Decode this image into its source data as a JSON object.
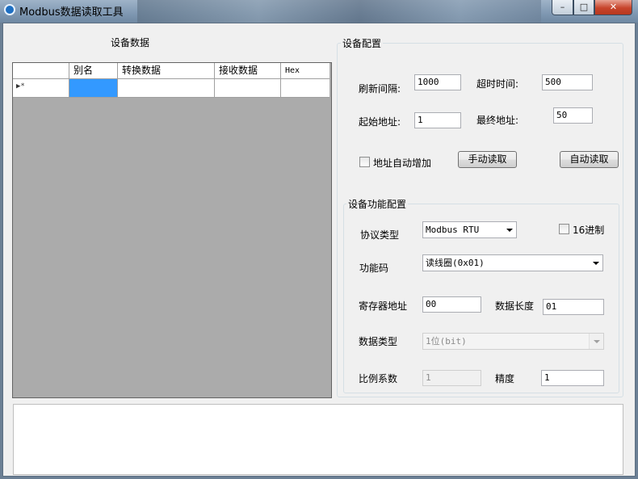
{
  "window": {
    "title": "Modbus数据读取工具",
    "controls": {
      "minimize": "–",
      "maximize": "□",
      "close": "✕"
    }
  },
  "grid": {
    "title": "设备数据",
    "columns": [
      "别名",
      "转换数据",
      "接收数据",
      "Hex"
    ],
    "new_row_marker": "▶*"
  },
  "config": {
    "legend": "设备配置",
    "refresh_label": "刷新间隔:",
    "refresh_value": "1000",
    "timeout_label": "超时时间:",
    "timeout_value": "500",
    "start_addr_label": "起始地址:",
    "start_addr_value": "1",
    "end_addr_label": "最终地址:",
    "end_addr_value": "50",
    "auto_inc_label": "地址自动增加",
    "manual_read": "手动读取",
    "auto_read": "自动读取"
  },
  "func": {
    "legend": "设备功能配置",
    "protocol_label": "协议类型",
    "protocol_value": "Modbus RTU",
    "hex_label": "16进制",
    "funccode_label": "功能码",
    "funccode_value": "读线圈(0x01)",
    "reg_addr_label": "寄存器地址",
    "reg_addr_value": "00",
    "data_len_label": "数据长度",
    "data_len_value": "01",
    "data_type_label": "数据类型",
    "data_type_value": "1位(bit)",
    "ratio_label": "比例系数",
    "ratio_value": "1",
    "precision_label": "精度",
    "precision_value": "1"
  }
}
